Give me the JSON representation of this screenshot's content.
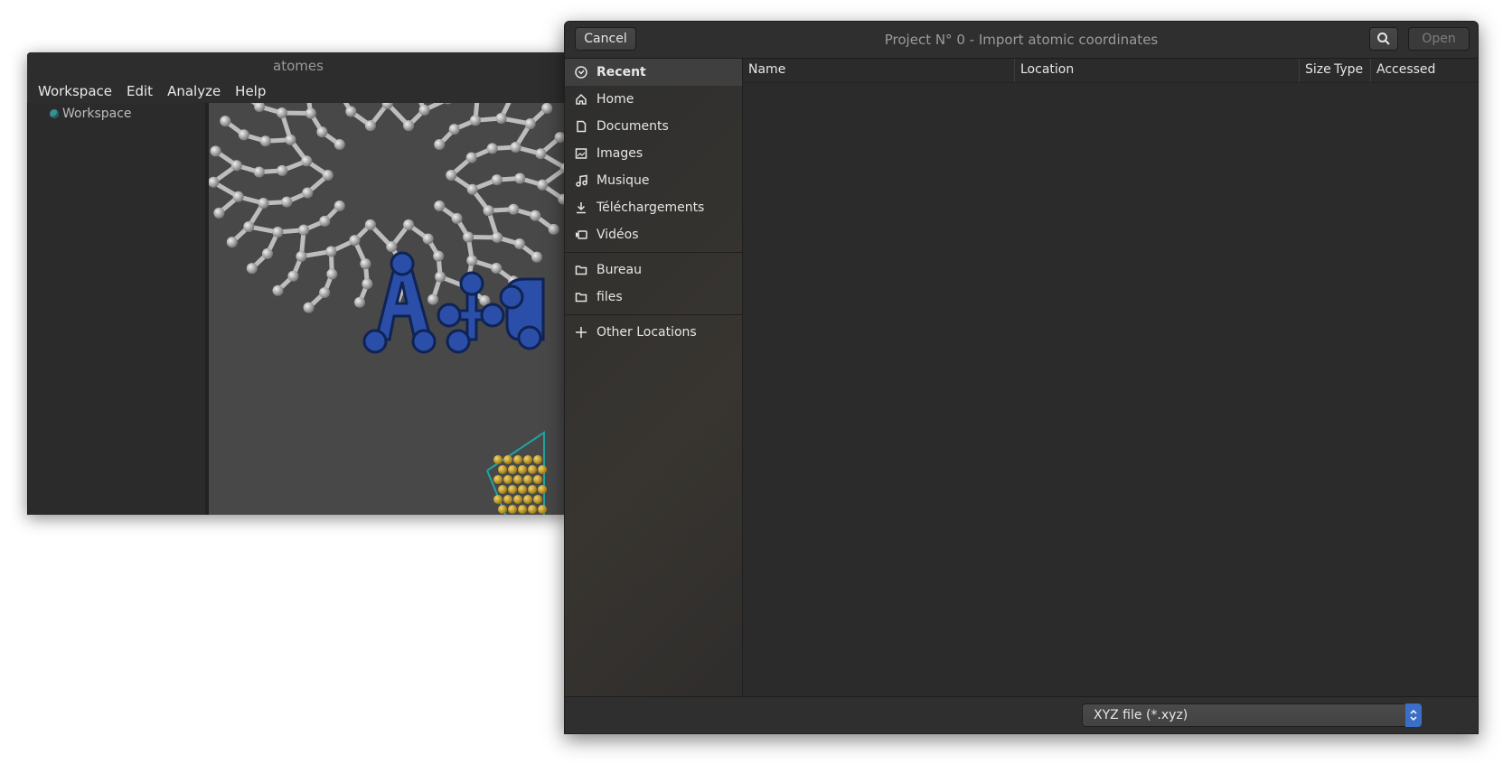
{
  "main_window": {
    "title": "atomes",
    "menu": [
      "Workspace",
      "Edit",
      "Analyze",
      "Help"
    ],
    "tree_item": "Workspace",
    "art_text": "At"
  },
  "dialog": {
    "title": "Project N° 0 - Import atomic coordinates",
    "cancel_label": "Cancel",
    "open_label": "Open",
    "places": [
      {
        "label": "Recent",
        "icon": "recent-icon"
      },
      {
        "label": "Home",
        "icon": "home-icon"
      },
      {
        "label": "Documents",
        "icon": "document-icon"
      },
      {
        "label": "Images",
        "icon": "image-icon"
      },
      {
        "label": "Musique",
        "icon": "music-icon"
      },
      {
        "label": "Téléchargements",
        "icon": "download-icon"
      },
      {
        "label": "Vidéos",
        "icon": "video-icon"
      }
    ],
    "bookmarks": [
      {
        "label": "Bureau",
        "icon": "folder-icon"
      },
      {
        "label": "files",
        "icon": "folder-icon"
      }
    ],
    "other_locations": "Other Locations",
    "columns": [
      "Name",
      "Location",
      "Size",
      "Type",
      "Accessed"
    ],
    "filter": "XYZ file (*.xyz)"
  },
  "colors": {
    "accent": "#3b6ec7",
    "molecule_blue": "#2b4fa8",
    "molecule_gold": "#c9a227",
    "cell_edge": "#1fa4a4"
  }
}
